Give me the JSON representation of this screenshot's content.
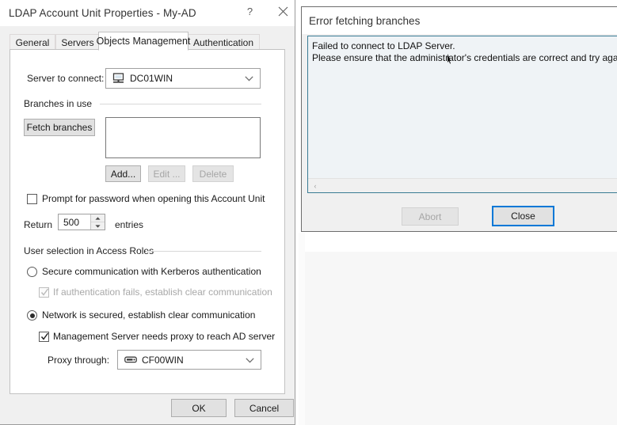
{
  "background": {
    "note": "partially visible application window behind dialogs"
  },
  "properties_dialog": {
    "title": "LDAP Account Unit Properties - My-AD",
    "titlebar_buttons": [
      {
        "name": "help",
        "glyph": "?"
      },
      {
        "name": "close",
        "glyph": "✕"
      }
    ],
    "tabs": [
      {
        "label": "General",
        "active": false
      },
      {
        "label": "Servers",
        "active": false
      },
      {
        "label": "Objects Management",
        "active": true
      },
      {
        "label": "Authentication",
        "active": false
      }
    ],
    "server_to_connect": {
      "label": "Server to connect:",
      "value": "DC01WIN",
      "icon": "computer-icon",
      "arrow": "chevron-down-icon"
    },
    "branches_group": {
      "label": "Branches in use",
      "fetch_button": "Fetch branches",
      "list_items": [],
      "buttons": [
        {
          "label": "Add...",
          "disabled": false
        },
        {
          "label": "Edit ...",
          "disabled": true
        },
        {
          "label": "Delete",
          "disabled": true
        }
      ]
    },
    "prompt_password": {
      "label": "Prompt for password when opening this Account Unit",
      "checked": false
    },
    "return_entries": {
      "prefix_label": "Return",
      "value": "500",
      "suffix_label": "entries"
    },
    "access_roles_group": {
      "label": "User selection in Access Roles",
      "kerberos_option": {
        "label": "Secure communication with Kerberos authentication",
        "selected": false
      },
      "auth_fail_option": {
        "label": "If authentication fails, establish clear communication",
        "checked": true,
        "disabled": true
      },
      "network_option": {
        "label": "Network is secured, establish clear communication",
        "selected": true
      },
      "proxy_option": {
        "label": "Management Server needs proxy to reach AD server",
        "checked": true
      },
      "proxy_through": {
        "label": "Proxy through:",
        "value": "CF00WIN",
        "icon": "gateway-device-icon",
        "arrow": "chevron-down-icon"
      }
    },
    "footer_buttons": [
      {
        "label": "OK",
        "disabled": false
      },
      {
        "label": "Cancel",
        "disabled": false
      }
    ]
  },
  "error_dialog": {
    "title": "Error fetching branches",
    "message_line_1": "Failed to connect to LDAP Server.",
    "message_line_2": "Please ensure that the administrator's credentials are correct and try again",
    "scrollbar_left_arrow": "‹",
    "buttons": [
      {
        "label": "Abort",
        "disabled": true,
        "default": false
      },
      {
        "label": "Close",
        "disabled": false,
        "default": true
      }
    ]
  },
  "colors": {
    "accent_focus": "#0078d7",
    "textarea_border": "#3a7b94",
    "dialog_face": "#f0f0f0",
    "button_face": "#e1e1e1"
  }
}
